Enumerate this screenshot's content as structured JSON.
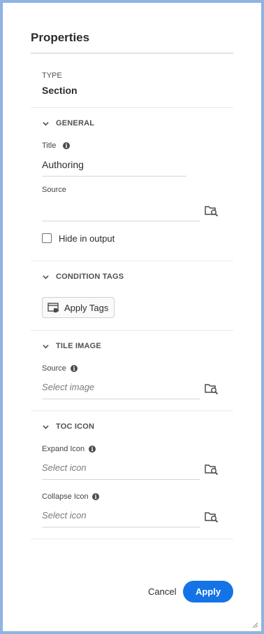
{
  "panel": {
    "title": "Properties",
    "type_label": "TYPE",
    "type_value": "Section"
  },
  "general": {
    "header": "GENERAL",
    "title_label": "Title",
    "title_value": "Authoring",
    "source_label": "Source",
    "source_value": "",
    "hide_label": "Hide in output",
    "hide_checked": false
  },
  "condition_tags": {
    "header": "CONDITION TAGS",
    "apply_tags_label": "Apply Tags"
  },
  "tile_image": {
    "header": "TILE IMAGE",
    "source_label": "Source",
    "source_placeholder": "Select image"
  },
  "toc_icon": {
    "header": "TOC ICON",
    "expand_label": "Expand Icon",
    "expand_placeholder": "Select icon",
    "collapse_label": "Collapse Icon",
    "collapse_placeholder": "Select icon"
  },
  "footer": {
    "cancel_label": "Cancel",
    "apply_label": "Apply"
  },
  "icons": {
    "info": "info-icon",
    "browse": "folder-search-icon",
    "chevron": "chevron-down-icon",
    "tag": "tag-icon"
  },
  "colors": {
    "accent": "#1473e6",
    "frame": "#8fb3e3"
  }
}
